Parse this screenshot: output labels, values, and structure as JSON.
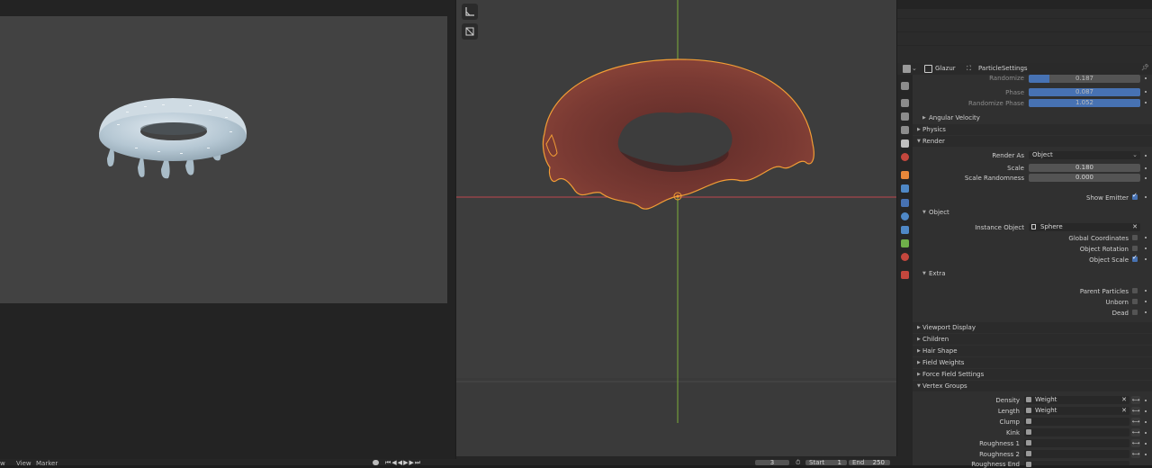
{
  "header": {
    "object_name": "Glazur",
    "settings_name": "ParticleSettings",
    "pin_icon": "pin-icon"
  },
  "rotation": {
    "randomize_label": "Randomize",
    "randomize_value": "0.187",
    "phase_label": "Phase",
    "phase_value": "0.087",
    "randomize_phase_label": "Randomize Phase",
    "randomize_phase_value": "1.052",
    "angular_velocity_label": "Angular Velocity"
  },
  "sections": {
    "physics": "Physics",
    "render": "Render",
    "viewport_display": "Viewport Display",
    "children": "Children",
    "hair_shape": "Hair Shape",
    "field_weights": "Field Weights",
    "force_field_settings": "Force Field Settings",
    "vertex_groups": "Vertex Groups"
  },
  "render": {
    "render_as_label": "Render As",
    "render_as_value": "Object",
    "scale_label": "Scale",
    "scale_value": "0.180",
    "scale_randomness_label": "Scale Randomness",
    "scale_randomness_value": "0.000",
    "show_emitter_label": "Show Emitter",
    "show_emitter_checked": true,
    "object_subpanel": "Object",
    "instance_object_label": "Instance Object",
    "instance_object_value": "Sphere",
    "global_coordinates_label": "Global Coordinates",
    "global_coordinates_checked": false,
    "object_rotation_label": "Object Rotation",
    "object_rotation_checked": false,
    "object_scale_label": "Object Scale",
    "object_scale_checked": true,
    "extra_subpanel": "Extra",
    "parent_particles_label": "Parent Particles",
    "parent_particles_checked": false,
    "unborn_label": "Unborn",
    "unborn_checked": false,
    "dead_label": "Dead",
    "dead_checked": false
  },
  "vertex_groups": {
    "density_label": "Density",
    "density_value": "Weight",
    "length_label": "Length",
    "length_value": "Weight",
    "clump_label": "Clump",
    "kink_label": "Kink",
    "roughness1_label": "Roughness 1",
    "roughness2_label": "Roughness 2",
    "roughness_end_label": "Roughness End"
  },
  "timeline": {
    "menu_view": "View",
    "menu_marker": "Marker",
    "menu_partial": "w",
    "current_frame": "3",
    "start_label": "Start",
    "start_value": "1",
    "end_label": "End",
    "end_value": "250"
  },
  "colors": {
    "accent": "#4772b3",
    "selection_outline": "#f29d35",
    "axis_x": "#c0464e",
    "axis_y": "#7fae3b",
    "glaze": "#b9c9d4",
    "chocolate": "#6b2f2a"
  }
}
